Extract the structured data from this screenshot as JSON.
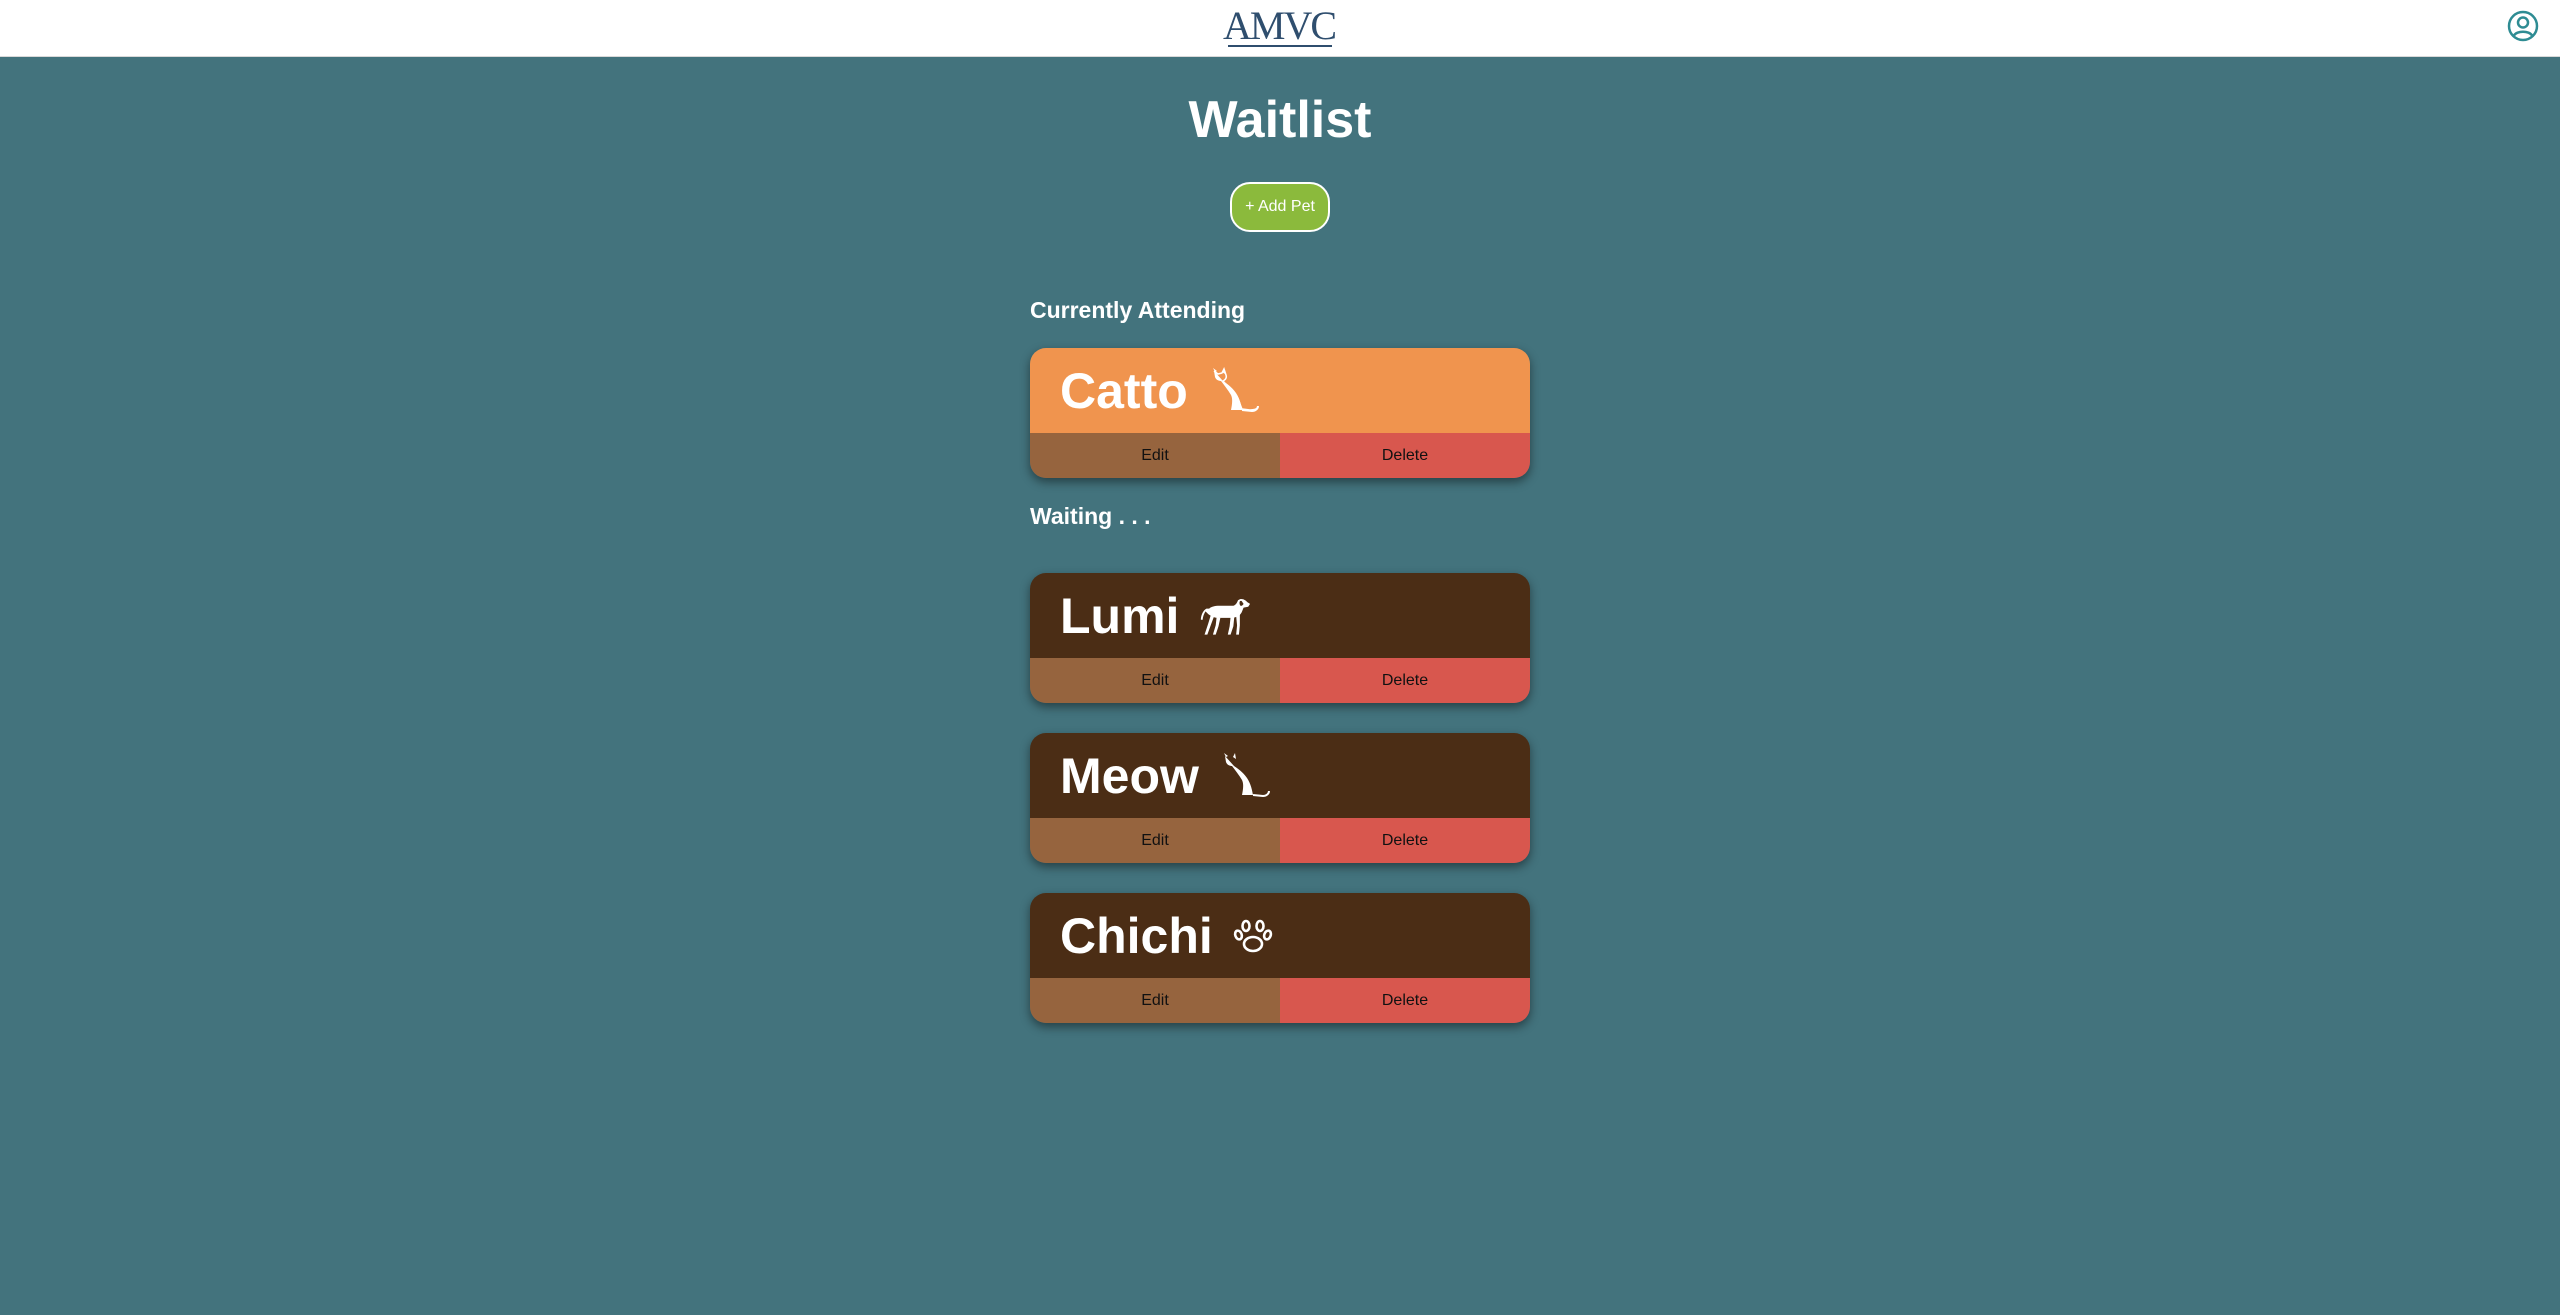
{
  "header": {
    "logo_text": "AMVC",
    "profile_icon": "user-circle-icon"
  },
  "page": {
    "title": "Waitlist",
    "add_button_label": "+ Add Pet"
  },
  "sections": {
    "attending_label": "Currently Attending",
    "waiting_label": "Waiting . . ."
  },
  "attending": [
    {
      "name": "Catto",
      "icon": "cat-icon",
      "edit_label": "Edit",
      "delete_label": "Delete"
    }
  ],
  "waiting": [
    {
      "name": "Lumi",
      "icon": "dog-icon",
      "edit_label": "Edit",
      "delete_label": "Delete"
    },
    {
      "name": "Meow",
      "icon": "cat-icon",
      "edit_label": "Edit",
      "delete_label": "Delete"
    },
    {
      "name": "Chichi",
      "icon": "paw-icon",
      "edit_label": "Edit",
      "delete_label": "Delete"
    }
  ],
  "colors": {
    "background": "#43737d",
    "attending_card": "#f0944e",
    "waiting_card": "#4b2d15",
    "edit_button": "#96643e",
    "delete_button": "#d8574e",
    "add_button": "#8bba3c"
  }
}
